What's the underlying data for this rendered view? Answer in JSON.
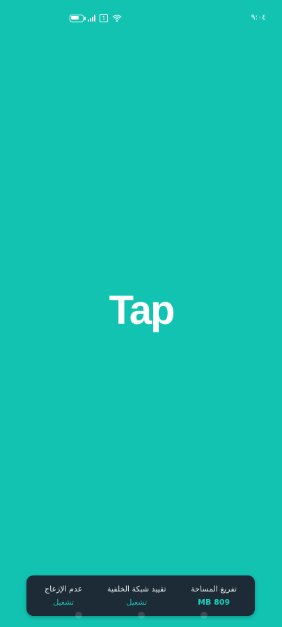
{
  "status_bar": {
    "time": "٩:٠٤",
    "icons": [
      "battery-icon",
      "signal-icon",
      "sim-icon",
      "wifi-icon"
    ]
  },
  "app": {
    "logo_text": "Tap",
    "background": "#12c3b2"
  },
  "quick_panel": {
    "items": [
      {
        "title": "تفريغ المساحة",
        "value": "809 MB"
      },
      {
        "title": "تقييد شبكة الخلفية",
        "value": "تشغيل"
      },
      {
        "title": "عدم الإزعاج",
        "value": "تشغيل"
      }
    ]
  }
}
